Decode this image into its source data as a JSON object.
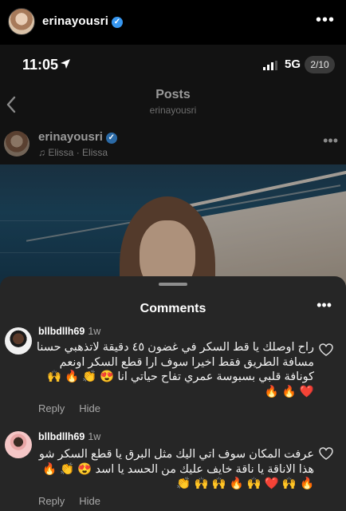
{
  "header": {
    "username": "erinayousri",
    "verified_icon": "verified-badge-icon",
    "more_icon": "more-horizontal-icon"
  },
  "status_bar": {
    "time": "11:05",
    "network": "5G",
    "page_indicator": "2/10"
  },
  "nav": {
    "title": "Posts",
    "subtitle": "erinayousri"
  },
  "post": {
    "username": "erinayousri",
    "music": "Elissa · Elissa"
  },
  "comments_sheet": {
    "title": "Comments",
    "items": [
      {
        "username": "bllbdllh69",
        "time": "1w",
        "text": "راح اوصلك يا قط السكر في غضون ٤٥ دقيقة لاتذهبي حسنا مسافة الطريق فقط اخيرا سوف ارا قطع السكر اونعم كونافة قلبي بسبوسة عمري تفاح حياتي انا 😍 👏 🔥 🙌 ❤️ 🔥 🔥",
        "reply_label": "Reply",
        "hide_label": "Hide"
      },
      {
        "username": "bllbdllh69",
        "time": "1w",
        "text": "عرفت المكان سوف اتي اليك مثل البرق يا قطع السكر شو هذا الاناقة يا ناقة خايف عليك من الحسد يا اسد 😍 👏 🔥 🔥 🙌 ❤️ 🙌 🔥 🙌 🙌 👏",
        "reply_label": "Reply",
        "hide_label": "Hide"
      }
    ]
  },
  "colors": {
    "background": "#000000",
    "sheet": "#262626",
    "verified": "#3797f0",
    "secondary_text": "#a8a8a8"
  }
}
